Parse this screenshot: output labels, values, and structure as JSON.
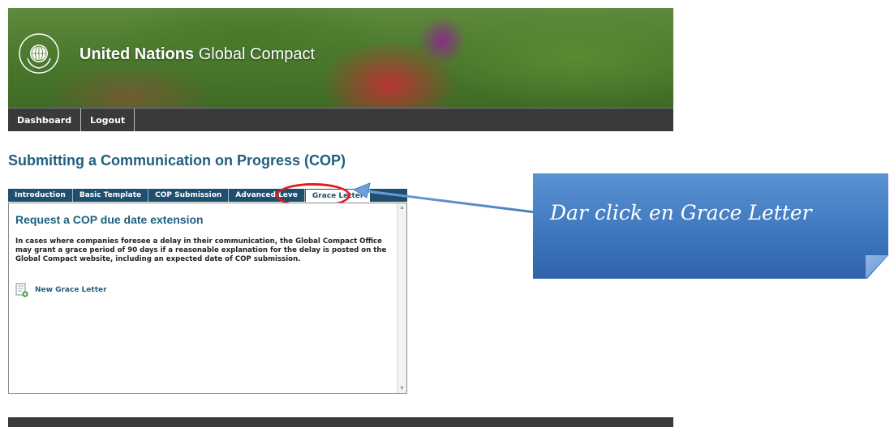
{
  "banner": {
    "title_strong": "United Nations",
    "title_light": "Global Compact",
    "logo_text": "THE GLOBAL COMPACT"
  },
  "topnav": {
    "items": [
      {
        "label": "Dashboard"
      },
      {
        "label": "Logout"
      }
    ]
  },
  "page": {
    "title": "Submitting a Communication on Progress (COP)"
  },
  "tabs": [
    {
      "label": "Introduction",
      "active": false
    },
    {
      "label": "Basic Template",
      "active": false
    },
    {
      "label": "COP Submission",
      "active": false
    },
    {
      "label": "Advanced Leve",
      "active": false
    },
    {
      "label": "Grace Letter",
      "active": true
    }
  ],
  "panel": {
    "heading": "Request a COP due date extension",
    "body": "In cases where companies foresee a delay in their communication, the Global Compact Office may grant a grace period of 90 days if a reasonable explanation for the delay is posted on the Global Compact website, including an expected date of COP submission.",
    "link_label": "New Grace Letter"
  },
  "callout": {
    "text": "Dar click en Grace Letter"
  },
  "colors": {
    "accent": "#1f5f7f",
    "nav_bg": "#3a3a3a",
    "highlight": "#e21b1b",
    "callout_bg": "#3f78be"
  },
  "icons": {
    "logo": "un-global-compact-logo",
    "new_document": "new-document-icon"
  }
}
